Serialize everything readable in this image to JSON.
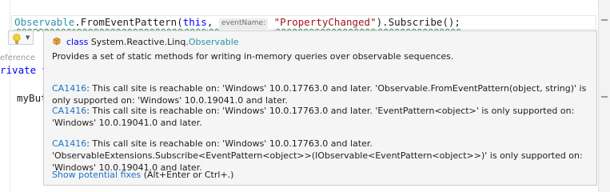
{
  "editor": {
    "code_tokens": {
      "type1": "Observable",
      "dot1": ".",
      "method1": "FromEventPattern(",
      "this_kw": "this",
      "comma": ", ",
      "param_hint": "eventName:",
      "string_arg": "\"PropertyChanged\"",
      "tail": ").Subscribe();"
    },
    "left_fragments": {
      "reference": "eference",
      "private_kw": "rivate v",
      "mybut": "myBut"
    }
  },
  "quick_actions": {
    "icon": "lightbulb-icon",
    "caret": "▼"
  },
  "tooltip": {
    "class_icon": "class-icon",
    "class_keyword": "class",
    "namespace": "System.Reactive.Linq.",
    "type_name": "Observable",
    "summary": "Provides a set of static methods for writing in-memory queries over observable sequences.",
    "diagnostics": [
      {
        "code": "CA1416",
        "message": ": This call site is reachable on: 'Windows' 10.0.17763.0 and later. 'Observable.FromEventPattern(object, string)' is only supported on: 'Windows' 10.0.19041.0 and later."
      },
      {
        "code": "CA1416",
        "message": ": This call site is reachable on: 'Windows' 10.0.17763.0 and later. 'EventPattern<object>' is only supported on: 'Windows' 10.0.19041.0 and later."
      },
      {
        "code": "CA1416",
        "message": ": This call site is reachable on: 'Windows' 10.0.17763.0 and later. 'ObservableExtensions.Subscribe<EventPattern<object>>(IObservable<EventPattern<object>>)' is only supported on: 'Windows' 10.0.19041.0 and later."
      }
    ],
    "fix_link": "Show potential fixes",
    "fix_shortcut": " (Alt+Enter or Ctrl+.)"
  },
  "colors": {
    "keyword": "#0000ff",
    "type": "#2b91af",
    "string": "#a31515",
    "link": "#1a73c8",
    "squiggle": "#2e8b57"
  }
}
